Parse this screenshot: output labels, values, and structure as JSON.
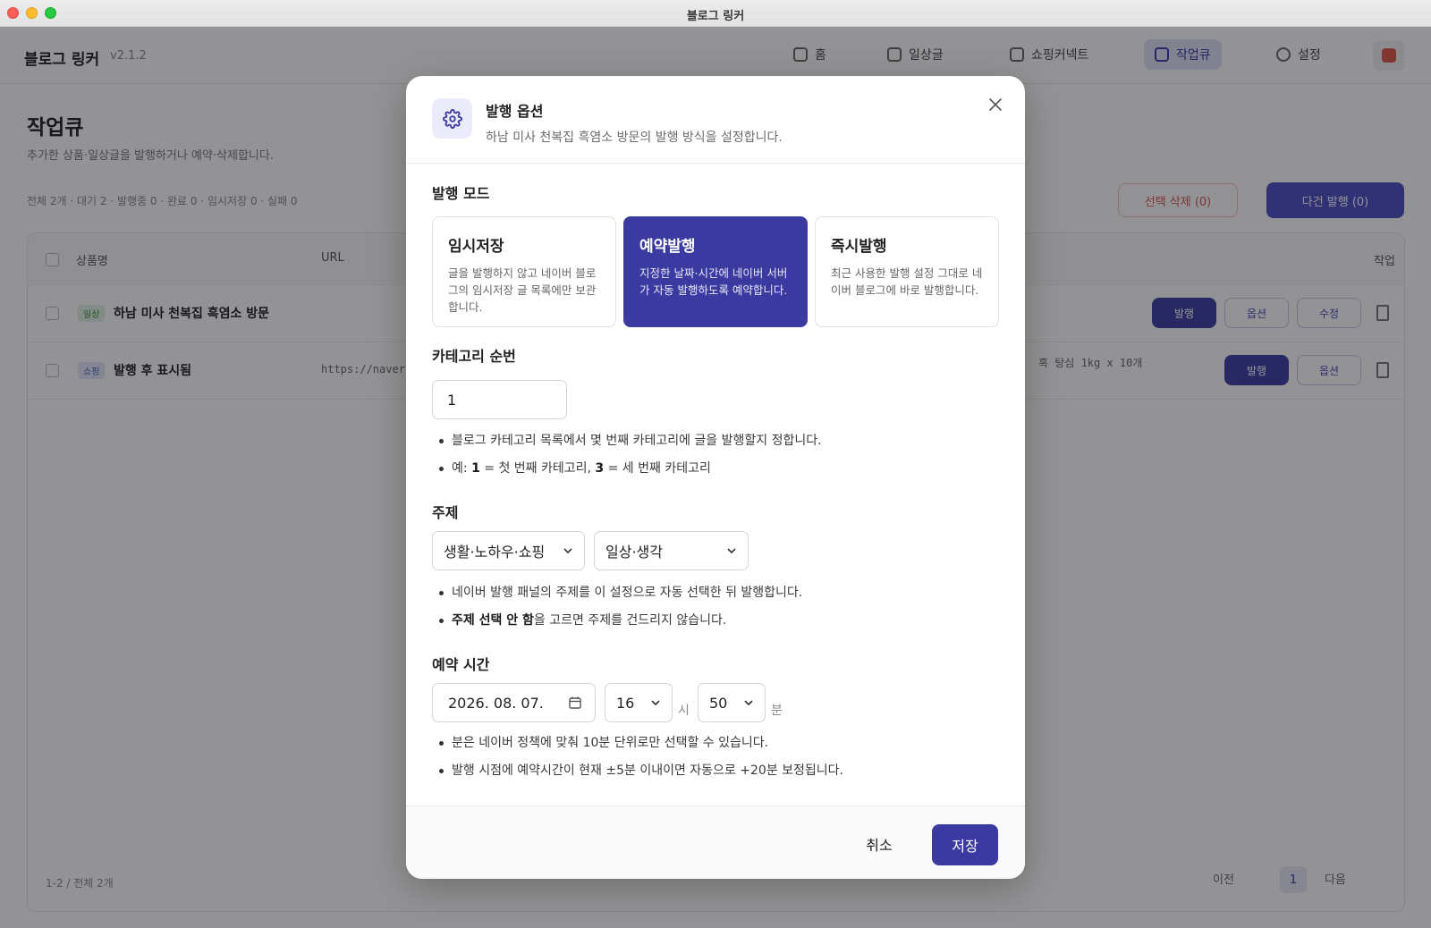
{
  "window": {
    "title": "블로그 링커"
  },
  "app": {
    "logo": "블로그 링커",
    "version": "v2.1.2",
    "nav": [
      {
        "label": "홈",
        "icon": "home-icon"
      },
      {
        "label": "일상글",
        "icon": "edit-icon"
      },
      {
        "label": "쇼핑커넥트",
        "icon": "calendar-icon"
      },
      {
        "label": "작업큐",
        "icon": "grid-icon"
      },
      {
        "label": "설정",
        "icon": "gear-icon"
      }
    ],
    "page_title": "작업큐",
    "page_desc": "추가한 상품·일상글을 발행하거나 예약·삭제합니다.",
    "stats": "전체 2개 · 대기 2 · 발행중 0 · 완료 0 · 임시저장 0 · 실패 0",
    "delete_selected": "선택 삭제 (0)",
    "bulk_publish": "다건 발행 (0)",
    "table": {
      "headers": [
        "상품명",
        "URL",
        "작업"
      ],
      "rows": [
        {
          "tag": "일상",
          "name": "하남 미사 천복집 흑염소 방문",
          "url": "",
          "actions": [
            "발행",
            "옵션",
            "수정"
          ]
        },
        {
          "tag": "쇼핑",
          "name": "발행 후 표시됨",
          "url": "https://naver...",
          "extra": "흑 탕심 1kg x 10개",
          "actions": [
            "발행",
            "옵션"
          ]
        }
      ],
      "count": "1-2 / 전체 2개",
      "prev": "이전",
      "page": "1",
      "next": "다음"
    }
  },
  "modal": {
    "title": "발행 옵션",
    "subtitle": "하남 미사 천복집 흑염소 방문의 발행 방식을 설정합니다.",
    "mode_label": "발행 모드",
    "modes": [
      {
        "title": "임시저장",
        "desc": "글을 발행하지 않고 네이버 블로그의 임시저장 글 목록에만 보관합니다.",
        "selected": false
      },
      {
        "title": "예약발행",
        "desc": "지정한 날짜·시간에 네이버 서버가 자동 발행하도록 예약합니다.",
        "selected": true
      },
      {
        "title": "즉시발행",
        "desc": "최근 사용한 발행 설정 그대로 네이버 블로그에 바로 발행합니다.",
        "selected": false
      }
    ],
    "category_label": "카테고리 순번",
    "category_value": "1",
    "category_notes": {
      "n1": "블로그 카테고리 목록에서 몇 번째 카테고리에 글을 발행할지 정합니다.",
      "n2_a": "예: ",
      "n2_b1": "1",
      "n2_c": " = 첫 번째 카테고리, ",
      "n2_b2": "3",
      "n2_d": " = 세 번째 카테고리"
    },
    "topic_label": "주제",
    "topic_main": "생활·노하우·쇼핑",
    "topic_sub": "일상·생각",
    "topic_notes": {
      "n1": "네이버 발행 패널의 주제를 이 설정으로 자동 선택한 뒤 발행합니다.",
      "n2_b": "주제 선택 안 함",
      "n2_rest": "을 고르면 주제를 건드리지 않습니다."
    },
    "schedule_label": "예약 시간",
    "date": "2026. 08. 07.",
    "hour": "16",
    "hour_unit": "시",
    "minute": "50",
    "minute_unit": "분",
    "schedule_notes": {
      "n1": "분은 네이버 정책에 맞춰 10분 단위로만 선택할 수 있습니다.",
      "n2": "발행 시점에 예약시간이 현재 ±5분 이내이면 자동으로 +20분 보정됩니다."
    },
    "cancel": "취소",
    "save": "저장"
  },
  "colors": {
    "accent": "#3a3aa1",
    "accent_light": "#ecebfb"
  }
}
